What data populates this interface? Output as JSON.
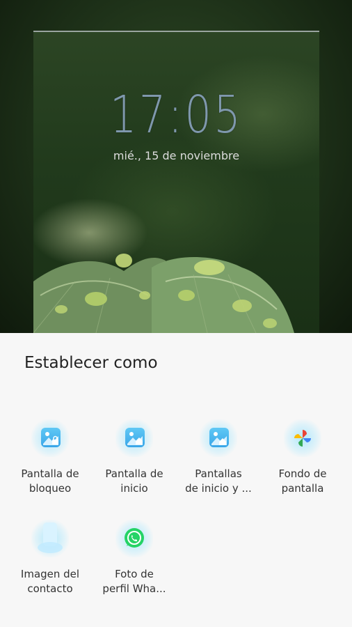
{
  "lock_preview": {
    "time": "17:05",
    "date": "mié., 15 de noviembre"
  },
  "sheet": {
    "title": "Establecer como",
    "options": [
      {
        "line1": "Pantalla de",
        "line2": "bloqueo"
      },
      {
        "line1": "Pantalla de",
        "line2": "inicio"
      },
      {
        "line1": "Pantallas",
        "line2": "de inicio y ..."
      },
      {
        "line1": "Fondo de",
        "line2": "pantalla"
      },
      {
        "line1": "Imagen del",
        "line2": "contacto"
      },
      {
        "line1": "Foto de",
        "line2": "perfil Wha..."
      }
    ]
  },
  "colors": {
    "clock": "#7f98ad",
    "sheet_bg": "#f7f7f7",
    "icon_blue": "#3aa6e8",
    "whatsapp_green": "#25d366"
  }
}
